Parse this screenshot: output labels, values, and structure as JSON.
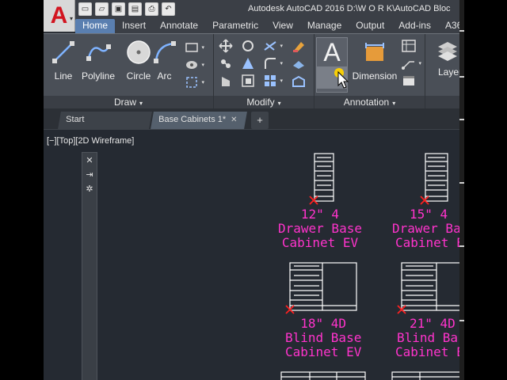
{
  "window": {
    "title": "Autodesk AutoCAD 2016    D:\\W O R K\\AutoCAD Bloc"
  },
  "app_button": {
    "logo": "A",
    "menu_arrow": "▾"
  },
  "quick_access": [
    {
      "icon": "new-file-icon",
      "glyph": "▭"
    },
    {
      "icon": "open-folder-icon",
      "glyph": "▱"
    },
    {
      "icon": "save-icon",
      "glyph": "▣"
    },
    {
      "icon": "save-as-icon",
      "glyph": "▤"
    },
    {
      "icon": "plot-icon",
      "glyph": "⎙"
    },
    {
      "icon": "undo-icon",
      "glyph": "↶"
    }
  ],
  "ribbon_tabs": [
    "Home",
    "Insert",
    "Annotate",
    "Parametric",
    "View",
    "Manage",
    "Output",
    "Add-ins",
    "A36"
  ],
  "active_tab": "Home",
  "draw_group": {
    "tools": [
      "Line",
      "Polyline",
      "Circle",
      "Arc"
    ],
    "title": "Draw"
  },
  "modify_group": {
    "title": "Modify"
  },
  "annotation_group": {
    "text_tool": "A",
    "dimension_tool": "Dimension",
    "title": "Annotation"
  },
  "layers_group": {
    "tool": "Layer Properti"
  },
  "file_tabs": {
    "start": "Start",
    "document": "Base Cabinets 1*",
    "close": "✕",
    "new_tab": "+"
  },
  "viewport": {
    "controls": "[−][Top][2D Wireframe]"
  },
  "navbar": [
    "✕",
    "⇥",
    "✲"
  ],
  "blocks": [
    {
      "line1": "12\"  4",
      "line2": "Drawer  Base",
      "line3": "Cabinet  EV"
    },
    {
      "line1": "15\"  4",
      "line2": "Drawer  Ba",
      "line3": "Cabinet  E"
    },
    {
      "line1": "18\"  4D",
      "line2": "Blind  Base",
      "line3": "Cabinet  EV"
    },
    {
      "line1": "21\"  4D",
      "line2": "Blind  Ba",
      "line3": "Cabinet  E"
    }
  ],
  "colors": {
    "accent_tab": "#5a7fb0",
    "cad_label": "#ff33cc",
    "cad_geometry": "#ffffff",
    "insertion_mark": "#ff2020",
    "logo_red": "#d2141f"
  }
}
